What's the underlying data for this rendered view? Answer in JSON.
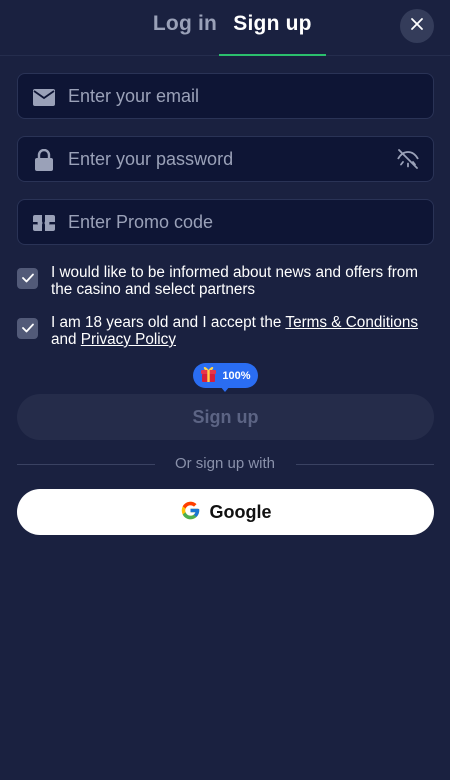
{
  "tabs": {
    "login_label": "Log in",
    "signup_label": "Sign up",
    "active": "signup"
  },
  "form": {
    "email": {
      "placeholder": "Enter your email",
      "value": ""
    },
    "password": {
      "placeholder": "Enter your password",
      "value": ""
    },
    "promo": {
      "placeholder": "Enter Promo code",
      "value": ""
    }
  },
  "consents": {
    "news": {
      "checked": true,
      "text": "I would like to be informed about news and offers from the casino and select partners"
    },
    "age": {
      "checked": true,
      "text_before": "I am 18 years old and I accept the ",
      "terms_label": "Terms & Conditions",
      "text_middle": " and ",
      "privacy_label": "Privacy Policy"
    }
  },
  "bonus_badge": {
    "label": "100%"
  },
  "signup_button": {
    "label": "Sign up"
  },
  "divider": {
    "label": "Or sign up with"
  },
  "google_button": {
    "label": "Google"
  },
  "icons": {
    "close": "close-icon",
    "email": "envelope-icon",
    "password": "lock-icon",
    "visibility": "eye-off-icon",
    "promo": "ticket-icon",
    "check": "checkmark-icon",
    "gift": "gift-icon",
    "google": "google-logo-icon"
  },
  "colors": {
    "background": "#1a2140",
    "input_bg": "#0e1535",
    "active_tab_underline": "#2bbf6d",
    "badge": "#2a6df2",
    "disabled_button": "#252c4a",
    "checkbox": "#525a78"
  }
}
